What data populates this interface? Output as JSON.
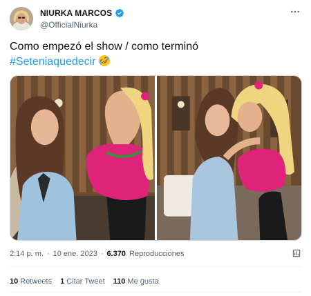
{
  "author": {
    "display_name": "NIURKA MARCOS",
    "handle": "@OfficialNiurka",
    "verified": true
  },
  "tweet": {
    "text_line1": "Como empezó el show / como terminó",
    "hashtag": "#Seteniaquedecir",
    "emoji": "rolling-on-floor-laughing-emoji"
  },
  "media": {
    "photos": [
      "photo-left",
      "photo-right"
    ]
  },
  "meta": {
    "time": "2:14 p. m.",
    "separator": "·",
    "date": "10 ene. 2023",
    "views_count": "6.370",
    "views_label": "Reproducciones"
  },
  "stats": {
    "retweets_count": "10",
    "retweets_label": "Retweets",
    "quotes_count": "1",
    "quotes_label": "Citar Tweet",
    "likes_count": "110",
    "likes_label": "Me gusta"
  },
  "colors": {
    "accent": "#1d9bf0",
    "text": "#0f1419",
    "secondary": "#536471",
    "border": "#cfd9de"
  }
}
